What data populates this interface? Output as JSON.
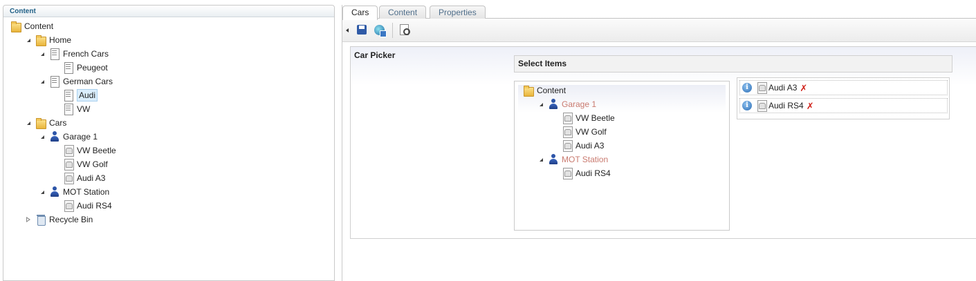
{
  "left_panel": {
    "header": "Content",
    "tree": [
      {
        "label": "Content",
        "icon": "folder-icon",
        "depth": 0,
        "toggle": "none"
      },
      {
        "label": "Home",
        "icon": "folder-icon",
        "depth": 1,
        "toggle": "expanded"
      },
      {
        "label": "French Cars",
        "icon": "document-icon",
        "depth": 2,
        "toggle": "expanded"
      },
      {
        "label": "Peugeot",
        "icon": "document-icon",
        "depth": 3,
        "toggle": "none"
      },
      {
        "label": "German Cars",
        "icon": "document-icon",
        "depth": 2,
        "toggle": "expanded"
      },
      {
        "label": "Audi",
        "icon": "document-icon",
        "depth": 3,
        "toggle": "none",
        "selected": true
      },
      {
        "label": "VW",
        "icon": "document-icon",
        "depth": 3,
        "toggle": "none"
      },
      {
        "label": "Cars",
        "icon": "folder-icon",
        "depth": 1,
        "toggle": "expanded"
      },
      {
        "label": "Garage 1",
        "icon": "person-icon",
        "depth": 2,
        "toggle": "expanded"
      },
      {
        "label": "VW Beetle",
        "icon": "car-icon",
        "depth": 3,
        "toggle": "none"
      },
      {
        "label": "VW Golf",
        "icon": "car-icon",
        "depth": 3,
        "toggle": "none"
      },
      {
        "label": "Audi A3",
        "icon": "car-icon",
        "depth": 3,
        "toggle": "none"
      },
      {
        "label": "MOT Station",
        "icon": "person-icon",
        "depth": 2,
        "toggle": "expanded"
      },
      {
        "label": "Audi RS4",
        "icon": "car-icon",
        "depth": 3,
        "toggle": "none"
      },
      {
        "label": "Recycle Bin",
        "icon": "recycle-bin-icon",
        "depth": 1,
        "toggle": "collapsed"
      }
    ]
  },
  "tabs": [
    {
      "label": "Cars",
      "active": true
    },
    {
      "label": "Content",
      "active": false
    },
    {
      "label": "Properties",
      "active": false
    }
  ],
  "toolbar": {
    "icons": [
      "collapse-arrow-icon",
      "save-icon",
      "save-and-publish-icon",
      "preview-icon"
    ]
  },
  "property": {
    "label": "Car Picker",
    "select_header": "Select Items",
    "picker_tree": [
      {
        "label": "Content",
        "icon": "folder-icon",
        "depth": 0,
        "toggle": "none"
      },
      {
        "label": "Garage 1",
        "icon": "person-icon",
        "depth": 1,
        "toggle": "expanded",
        "style": "disabled"
      },
      {
        "label": "VW Beetle",
        "icon": "car-icon",
        "depth": 2,
        "toggle": "none"
      },
      {
        "label": "VW Golf",
        "icon": "car-icon",
        "depth": 2,
        "toggle": "none"
      },
      {
        "label": "Audi A3",
        "icon": "car-icon",
        "depth": 2,
        "toggle": "none"
      },
      {
        "label": "MOT Station",
        "icon": "person-icon",
        "depth": 1,
        "toggle": "expanded",
        "style": "disabled"
      },
      {
        "label": "Audi RS4",
        "icon": "car-icon",
        "depth": 2,
        "toggle": "none"
      }
    ],
    "selected_items": [
      {
        "label": "Audi A3"
      },
      {
        "label": "Audi RS4"
      }
    ],
    "info_glyph": "i",
    "remove_glyph": "✗"
  },
  "colors": {
    "header_text": "#1f5f86",
    "disabled_node": "#c97a6f",
    "remove": "#d0221a",
    "selection_bg": "#dbeefc"
  }
}
